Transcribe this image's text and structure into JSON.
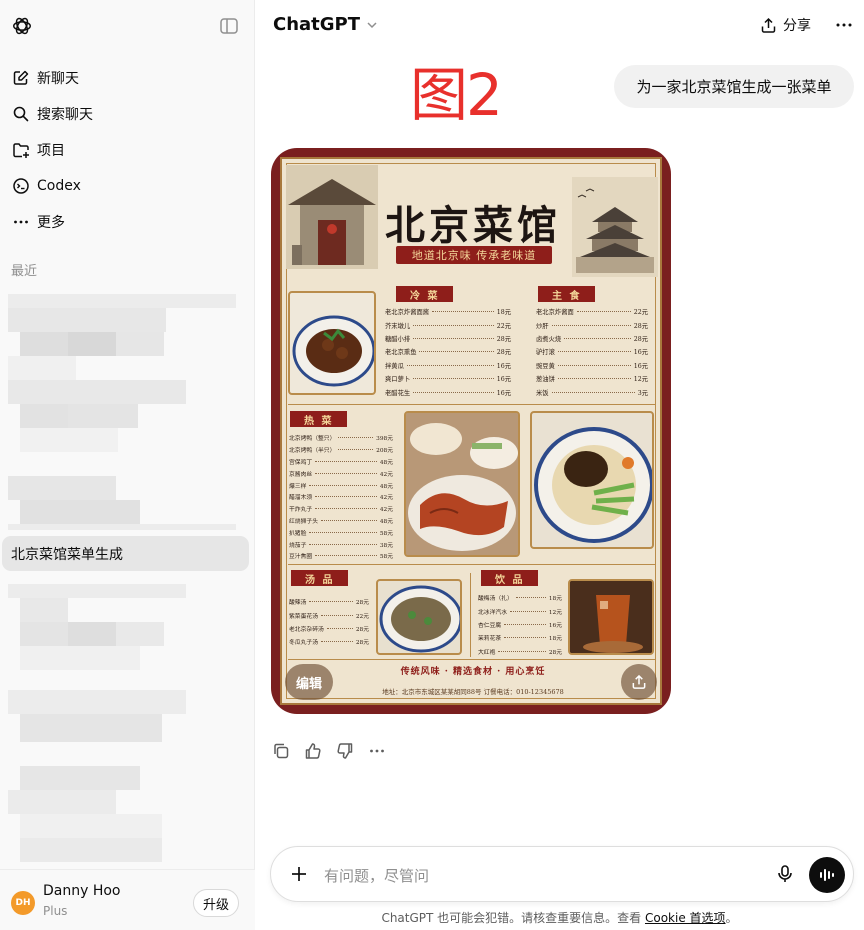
{
  "sidebar": {
    "nav": [
      {
        "label": "新聊天",
        "icon": "new-chat-icon"
      },
      {
        "label": "搜索聊天",
        "icon": "search-icon"
      },
      {
        "label": "项目",
        "icon": "folder-plus-icon"
      },
      {
        "label": "Codex",
        "icon": "codex-icon"
      },
      {
        "label": "更多",
        "icon": "more-dots-icon"
      }
    ],
    "recent_label": "最近",
    "active_chat": "北京菜馆菜单生成",
    "user": {
      "initials": "DH",
      "name": "Danny Hoo",
      "plan": "Plus",
      "upgrade_label": "升级"
    }
  },
  "header": {
    "model": "ChatGPT",
    "share_label": "分享"
  },
  "annotation": "图2",
  "user_message": "为一家北京菜馆生成一张菜单",
  "generated_image": {
    "title": "北京菜馆",
    "subtitle": "地道北京味  传承老味道",
    "sections": {
      "cold": {
        "tag": "冷 菜",
        "items": [
          {
            "name": "老北京炸酱面酱",
            "price": "18元"
          },
          {
            "name": "芥末墩儿",
            "price": "22元"
          },
          {
            "name": "糖醋小排",
            "price": "28元"
          },
          {
            "name": "老北京熏鱼",
            "price": "28元"
          },
          {
            "name": "拌黄瓜",
            "price": "16元"
          },
          {
            "name": "爽口萝卜",
            "price": "16元"
          },
          {
            "name": "老醋花生",
            "price": "16元"
          }
        ]
      },
      "staple": {
        "tag": "主 食",
        "items": [
          {
            "name": "老北京炸酱面",
            "price": "22元"
          },
          {
            "name": "炒肝",
            "price": "28元"
          },
          {
            "name": "卤煮火烧",
            "price": "28元"
          },
          {
            "name": "驴打滚",
            "price": "16元"
          },
          {
            "name": "豌豆黄",
            "price": "16元"
          },
          {
            "name": "葱油饼",
            "price": "12元"
          },
          {
            "name": "米饭",
            "price": "3元"
          }
        ]
      },
      "hot": {
        "tag": "热 菜",
        "items": [
          {
            "name": "北京烤鸭（整只）",
            "price": "398元"
          },
          {
            "name": "北京烤鸭（半只）",
            "price": "208元"
          },
          {
            "name": "宫保鸡丁",
            "price": "48元"
          },
          {
            "name": "京酱肉丝",
            "price": "42元"
          },
          {
            "name": "爆三样",
            "price": "48元"
          },
          {
            "name": "醋溜木须",
            "price": "42元"
          },
          {
            "name": "干炸丸子",
            "price": "42元"
          },
          {
            "name": "红烧狮子头",
            "price": "48元"
          },
          {
            "name": "扒猪脸",
            "price": "58元"
          },
          {
            "name": "烧茄子",
            "price": "38元"
          },
          {
            "name": "豆汁焦圈",
            "price": "58元"
          }
        ]
      },
      "soup": {
        "tag": "汤 品",
        "items": [
          {
            "name": "酸辣汤",
            "price": "28元"
          },
          {
            "name": "紫菜蛋花汤",
            "price": "22元"
          },
          {
            "name": "老北京杂碎汤",
            "price": "28元"
          },
          {
            "name": "冬瓜丸子汤",
            "price": "28元"
          }
        ]
      },
      "drink": {
        "tag": "饮 品",
        "items": [
          {
            "name": "酸梅汤（扎）",
            "price": "18元"
          },
          {
            "name": "北冰洋汽水",
            "price": "12元"
          },
          {
            "name": "杏仁豆腐",
            "price": "16元"
          },
          {
            "name": "茉莉花茶",
            "price": "18元"
          },
          {
            "name": "大红袍",
            "price": "28元"
          }
        ]
      }
    },
    "footer": "传统风味 · 精选食材 · 用心烹饪",
    "address": "地址：北京市东城区某某胡同88号    订餐电话：010-12345678",
    "edit_label": "编辑"
  },
  "composer": {
    "placeholder": "有问题，尽管问"
  },
  "disclaimer": {
    "text": "ChatGPT 也可能会犯错。请核查重要信息。查看 ",
    "link": "Cookie 首选项",
    "suffix": "。"
  },
  "colors": {
    "annotation_red": "#e8302c",
    "menu_red": "#8e1e1a",
    "avatar_orange": "#f39a2a"
  }
}
